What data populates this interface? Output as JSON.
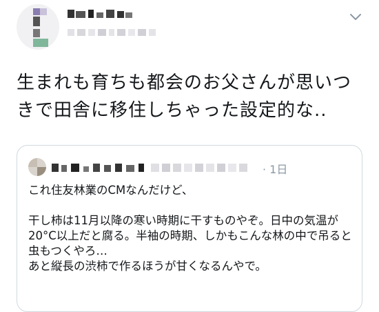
{
  "tweet": {
    "text_line1": "生まれも育ちも都会のお父さんが思いつ",
    "text_line2": "きで田舎に移住しちゃった設定的な.."
  },
  "quote": {
    "timestamp": "· 1日",
    "text": "これ住友林業のCMなんだけど、\n\n干し柿は11月以降の寒い時期に干すものやぞ。日中の気温が20°C以上だと腐る。半袖の時期、しかもこんな林の中で吊ると虫もつくやろ…\nあと縦長の渋柿で作るほうが甘くなるんやで。"
  },
  "icons": {
    "menu": "chevron-down-icon"
  },
  "colors": {
    "border": "#cfd9de",
    "muted": "#8b98a5",
    "text": "#14171a"
  }
}
